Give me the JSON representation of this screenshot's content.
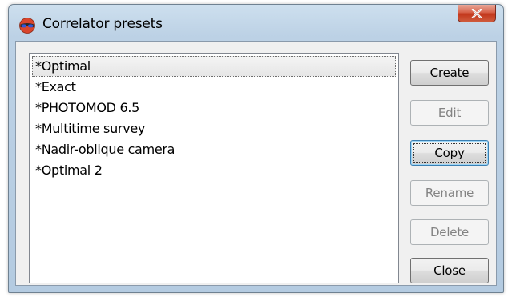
{
  "window": {
    "title": "Correlator presets",
    "icon": "red-blue-3d-glasses-icon",
    "close_label": "x"
  },
  "presets": {
    "items": [
      {
        "label": "*Optimal",
        "selected": true
      },
      {
        "label": "*Exact",
        "selected": false
      },
      {
        "label": "*PHOTOMOD 6.5",
        "selected": false
      },
      {
        "label": "*Multitime survey",
        "selected": false
      },
      {
        "label": "*Nadir-oblique camera",
        "selected": false
      },
      {
        "label": "*Optimal 2",
        "selected": false
      }
    ]
  },
  "buttons": {
    "create": {
      "label": "Create",
      "enabled": true
    },
    "edit": {
      "label": "Edit",
      "enabled": false
    },
    "copy": {
      "label": "Copy",
      "enabled": true
    },
    "rename": {
      "label": "Rename",
      "enabled": false
    },
    "delete": {
      "label": "Delete",
      "enabled": false
    },
    "close": {
      "label": "Close",
      "enabled": true
    }
  },
  "colors": {
    "frame": "#b4cbe1",
    "close_button": "#c2361b",
    "selection": "#e6e6e6"
  }
}
